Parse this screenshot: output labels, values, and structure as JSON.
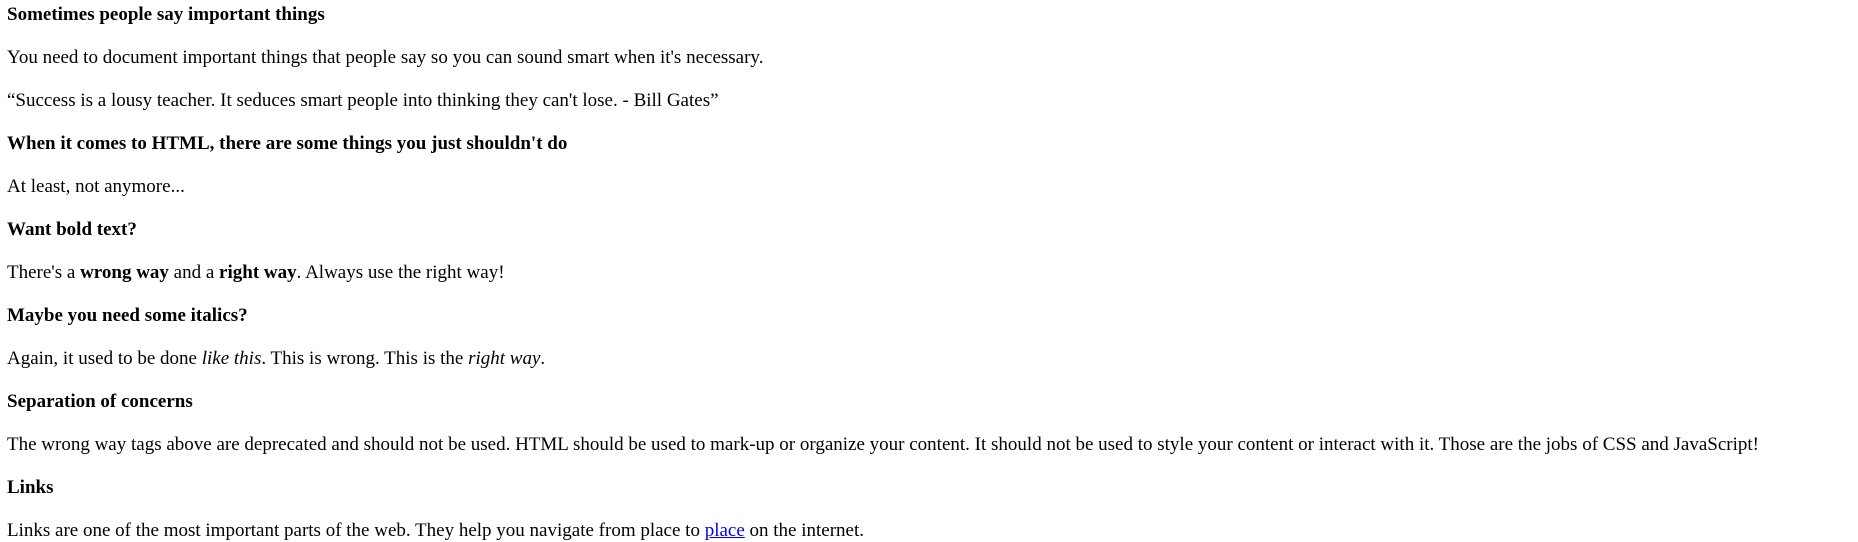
{
  "sections": {
    "quotes": {
      "heading": "Sometimes people say important things",
      "intro": "You need to document important things that people say so you can sound smart when it's necessary.",
      "quote": "“Success is a lousy teacher. It seduces smart people into thinking they can't lose. - Bill Gates”"
    },
    "dont": {
      "heading": "When it comes to HTML, there are some things you just shouldn't do",
      "text": "At least, not anymore..."
    },
    "bold": {
      "heading": "Want bold text?",
      "part1": "There's a ",
      "wrong": "wrong way",
      "part2": " and a ",
      "right": "right way",
      "part3": ". Always use the right way!"
    },
    "italics": {
      "heading": "Maybe you need some italics?",
      "part1": "Again, it used to be done ",
      "wrong": "like this",
      "part2": ". This is wrong. This is the ",
      "right": "right way",
      "part3": "."
    },
    "separation": {
      "heading": "Separation of concerns",
      "text": "The wrong way tags above are deprecated and should not be used. HTML should be used to mark-up or organize your content. It should not be used to style your content or interact with it. Those are the jobs of CSS and JavaScript!"
    },
    "links": {
      "heading": "Links",
      "part1": "Links are one of the most important parts of the web. They help you navigate from place to ",
      "link_text": "place",
      "part2": " on the internet."
    }
  },
  "colors": {
    "link": "#0000ee",
    "text": "#000000",
    "background": "#ffffff"
  }
}
